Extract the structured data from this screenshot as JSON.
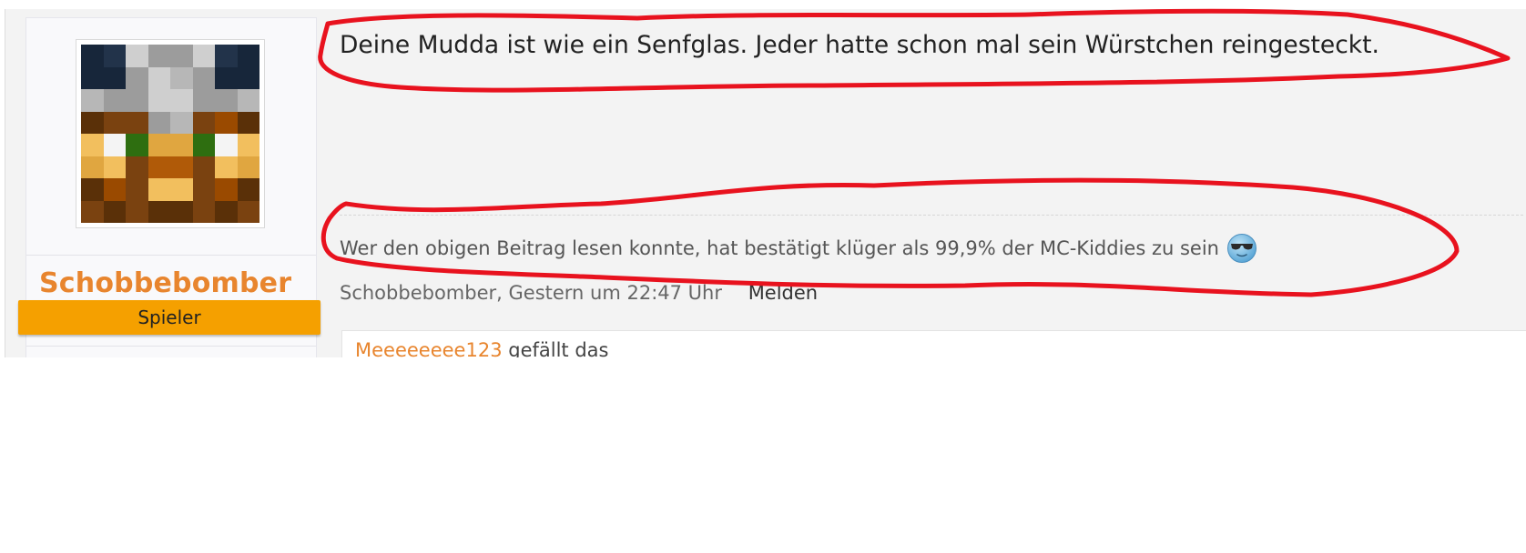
{
  "post": {
    "message": "Deine Mudda ist wie ein Senfglas. Jeder hatte schon mal sein Würstchen reingesteckt.",
    "signature": "Wer den obigen Beitrag lesen konnte, hat bestätigt klüger als 99,9% der MC-Kiddies zu sein",
    "signature_icon": "cool-smiley-icon",
    "author": "Schobbebomber",
    "date": "Gestern um 22:47 Uhr",
    "report_label": "Melden",
    "likes_user": "Meeeeeeee123",
    "likes_suffix": "gefällt das"
  },
  "user": {
    "name": "Schobbebomber",
    "rank": "Spieler",
    "avatar_icon": "minecraft-skin-face-avatar"
  },
  "colors": {
    "username": "#e8852e",
    "rank_badge": "#f5a000",
    "annotation_red": "#e8121e",
    "post_background": "#f3f3f3"
  }
}
